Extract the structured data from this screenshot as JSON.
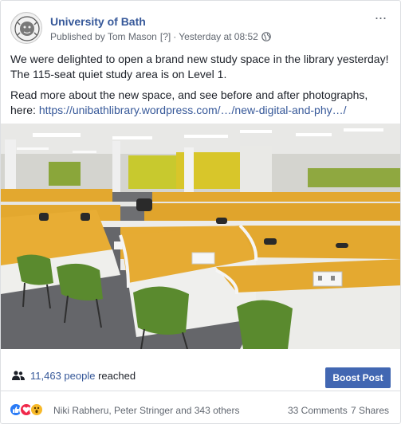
{
  "post": {
    "page_name": "University of Bath",
    "published_by": "Published by Tom Mason",
    "help_marker": "[?]",
    "separator": "·",
    "time": "Yesterday at 08:52",
    "more_glyph": "···",
    "paragraph1": "We were delighted to open a brand new study space in the library yesterday! The 115-seat quiet study area is on Level 1.",
    "paragraph2_prefix": "Read more about the new space, and see before and after photographs, here: ",
    "paragraph2_link": "https://unibathlibrary.wordpress.com/…/new-digital-and-phy…/"
  },
  "photo": {
    "description_icon": "study-space-photo"
  },
  "reach": {
    "count": "11,463 people",
    "label": " reached",
    "boost_label": "Boost Post"
  },
  "reactions": {
    "names": "Niki Rabheru, Peter Stringer and 343 others",
    "comments": "33 Comments",
    "shares": "7 Shares"
  },
  "colors": {
    "link": "#365899",
    "boost_button": "#4267b2",
    "desk_panel": "#e3a82f",
    "chair": "#5a8a2e"
  }
}
